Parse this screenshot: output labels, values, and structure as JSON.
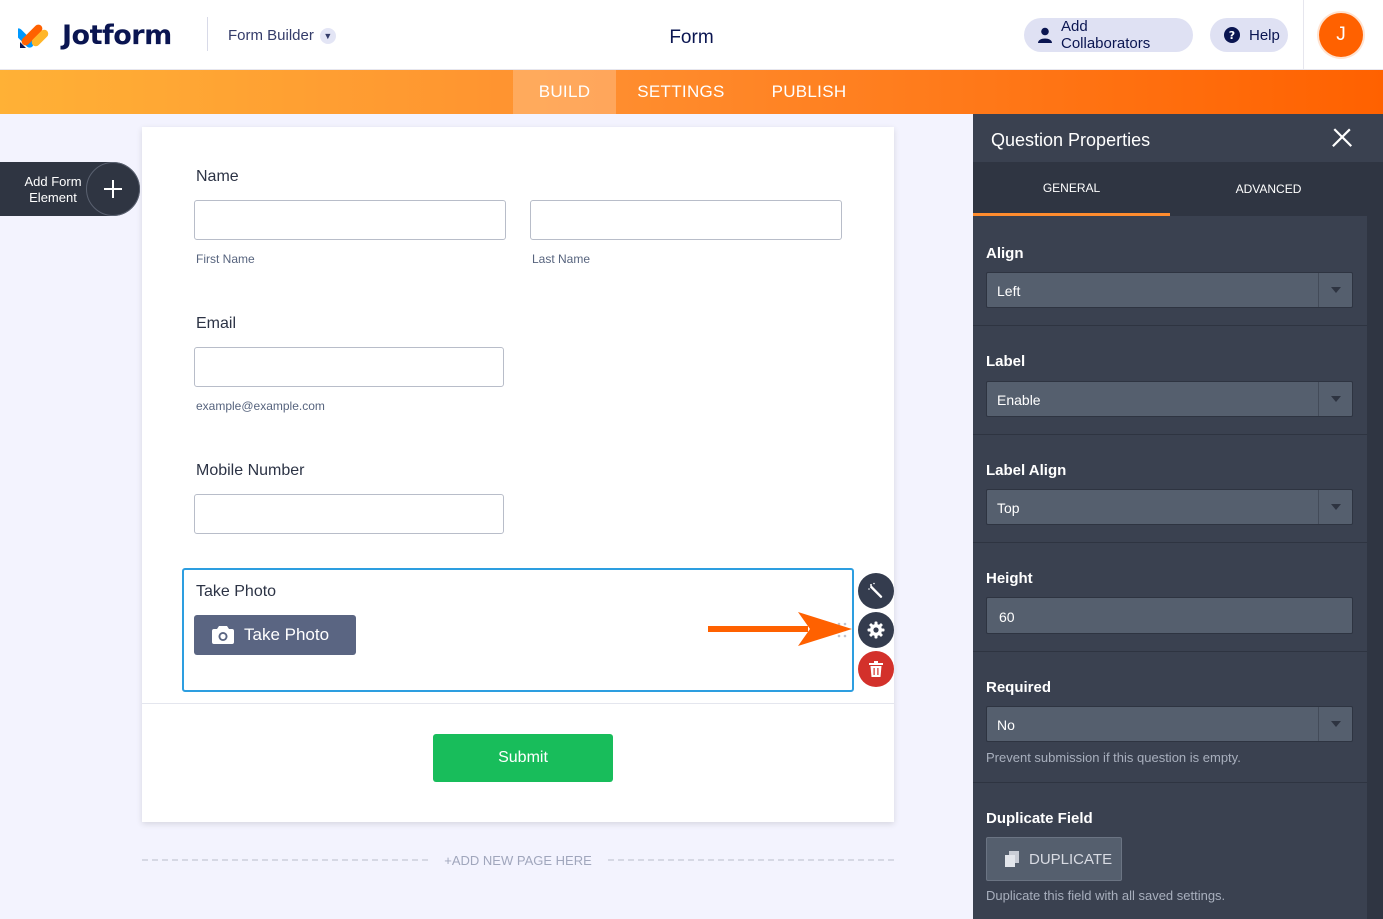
{
  "header": {
    "logo_text": "Jotform",
    "builder_menu": "Form Builder",
    "title": "Form",
    "add_collaborators": "Add Collaborators",
    "help": "Help",
    "avatar_initial": "J"
  },
  "nav": {
    "tabs": [
      {
        "label": "BUILD",
        "active": true
      },
      {
        "label": "SETTINGS",
        "active": false
      },
      {
        "label": "PUBLISH",
        "active": false
      }
    ]
  },
  "add_element": {
    "label": "Add Form Element"
  },
  "form": {
    "name": {
      "label": "Name",
      "first_sub": "First Name",
      "last_sub": "Last Name"
    },
    "email": {
      "label": "Email",
      "sub": "example@example.com"
    },
    "mobile": {
      "label": "Mobile Number"
    },
    "take_photo": {
      "label": "Take Photo",
      "button": "Take Photo"
    },
    "submit": "Submit",
    "add_page": "+ADD NEW PAGE HERE"
  },
  "panel": {
    "title": "Question Properties",
    "tabs": [
      "GENERAL",
      "ADVANCED"
    ],
    "properties": {
      "align": {
        "label": "Align",
        "value": "Left"
      },
      "label": {
        "label": "Label",
        "value": "Enable"
      },
      "label_align": {
        "label": "Label Align",
        "value": "Top"
      },
      "height": {
        "label": "Height",
        "value": "60"
      },
      "required": {
        "label": "Required",
        "value": "No",
        "help": "Prevent submission if this question is empty."
      },
      "duplicate": {
        "label": "Duplicate Field",
        "button": "DUPLICATE",
        "help": "Duplicate this field with all saved settings."
      }
    }
  },
  "colors": {
    "brand_orange": "#ff6100",
    "nav_gradient_start": "#ffb136",
    "submit_green": "#18bd5b",
    "selected_border": "#2d9ee0",
    "delete_red": "#d3312b",
    "panel_bg": "#3a4150"
  }
}
